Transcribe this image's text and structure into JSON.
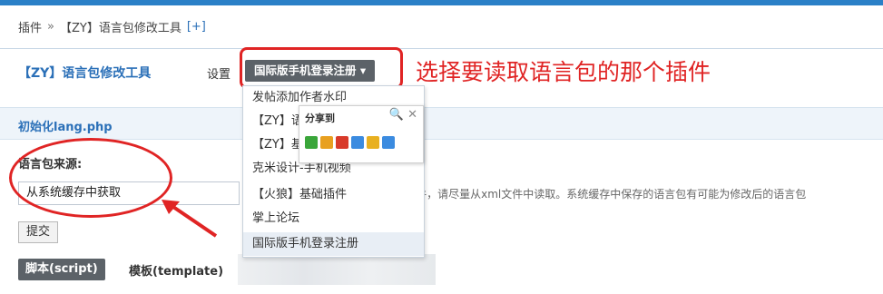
{
  "breadcrumb": {
    "plugins": "插件",
    "separator": "»",
    "current": "【ZY】语言包修改工具",
    "add": "[+]"
  },
  "header": {
    "plugin_title": "【ZY】语言包修改工具",
    "settings": "设置",
    "selected_plugin": "国际版手机登录注册 ▾"
  },
  "annotation": {
    "callout": "选择要读取语言包的那个插件"
  },
  "dropdown": {
    "items": [
      {
        "label": "发帖添加作者水印"
      },
      {
        "label": "【ZY】语言包修改工具"
      },
      {
        "label": "【ZY】基础插件"
      },
      {
        "label": "克米设计-手机视频"
      },
      {
        "label": "【火狼】基础插件"
      },
      {
        "label": "掌上论坛"
      },
      {
        "label": "国际版手机登录注册"
      }
    ]
  },
  "share": {
    "title": "分享到",
    "tools": "🔍 ✕",
    "icon_colors": [
      "#3aa63a",
      "#e8a020",
      "#d83a2a",
      "#3b8be0",
      "#e8b020",
      "#3b8be0"
    ]
  },
  "section": {
    "title": "初始化lang.php"
  },
  "form": {
    "source_label": "语言包来源:",
    "source_value": "从系统缓存中获取",
    "hint": "若存在xml文件，请尽量从xml文件中读取。系统缓存中保存的语言包有可能为修改后的语言包",
    "submit": "提交"
  },
  "tabs": {
    "script": "脚本(script)",
    "template": "模板(template)"
  },
  "colors": {
    "accent": "#2b70b8",
    "annotation": "#e02424",
    "dark_button": "#5c6268"
  }
}
